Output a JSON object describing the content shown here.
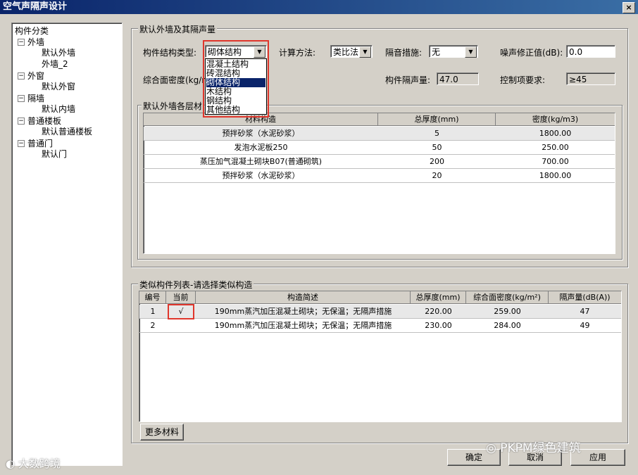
{
  "window": {
    "title": "空气声隔声设计",
    "close": "×"
  },
  "tree": {
    "root": "构件分类",
    "groups": [
      {
        "label": "外墙",
        "children": [
          "默认外墙",
          "外墙_2"
        ]
      },
      {
        "label": "外窗",
        "children": [
          "默认外窗"
        ]
      },
      {
        "label": "隔墙",
        "children": [
          "默认内墙"
        ]
      },
      {
        "label": "普通楼板",
        "children": [
          "默认普通楼板"
        ]
      },
      {
        "label": "普通门",
        "children": [
          "默认门"
        ]
      }
    ],
    "expander": "−"
  },
  "wall_section": {
    "title": "默认外墙及其隔声量",
    "struct_type_label": "构件结构类型:",
    "struct_type_value": "砌体结构",
    "struct_options": [
      "混凝土结构",
      "砖混结构",
      "砌体结构",
      "木结构",
      "钢结构",
      "其他结构"
    ],
    "struct_selected_index": 2,
    "calc_label": "计算方法:",
    "calc_value": "类比法",
    "measure_label": "隔音措施:",
    "measure_value": "无",
    "noise_label": "噪声修正值(dB):",
    "noise_value": "0.0",
    "density_label": "综合面密度(kg/m",
    "insulation_label": "构件隔声量:",
    "insulation_value": "47.0",
    "control_label": "控制项要求:",
    "control_value": "≥45"
  },
  "layers": {
    "title": "默认外墙各层材",
    "headers": [
      "材料构造",
      "总厚度(mm)",
      "密度(kg/m3)"
    ],
    "rows": [
      [
        "预拌砂浆（水泥砂浆）",
        "5",
        "1800.00"
      ],
      [
        "发泡水泥板250",
        "50",
        "250.00"
      ],
      [
        "蒸压加气混凝土砌块B07(普通砌筑)",
        "200",
        "700.00"
      ],
      [
        "预拌砂浆（水泥砂浆）",
        "20",
        "1800.00"
      ]
    ]
  },
  "similar": {
    "title": "类似构件列表-请选择类似构造",
    "headers": [
      "编号",
      "当前",
      "构造简述",
      "总厚度(mm)",
      "综合面密度(kg/m²)",
      "隔声量(dB(A))"
    ],
    "rows": [
      [
        "1",
        "√",
        "190mm蒸汽加压混凝土砌块；无保温；无隔声措施",
        "220.00",
        "259.00",
        "47"
      ],
      [
        "2",
        "",
        "190mm蒸汽加压混凝土砌块；无保温；无隔声措施",
        "230.00",
        "284.00",
        "49"
      ]
    ],
    "more_button": "更多材料"
  },
  "buttons": {
    "ok": "确定",
    "cancel": "取消",
    "apply": "应用"
  },
  "watermarks": {
    "left": "大数跨境",
    "right": "PKPM绿色建筑"
  },
  "icons": [
    "close-icon",
    "dropdown-arrow-icon",
    "tree-collapse-icon",
    "wechat-icon"
  ],
  "colors": {
    "titlebar": "#0a246a",
    "highlight_box": "#e0362c",
    "selection": "#0a246a",
    "face": "#d4d0c8"
  }
}
